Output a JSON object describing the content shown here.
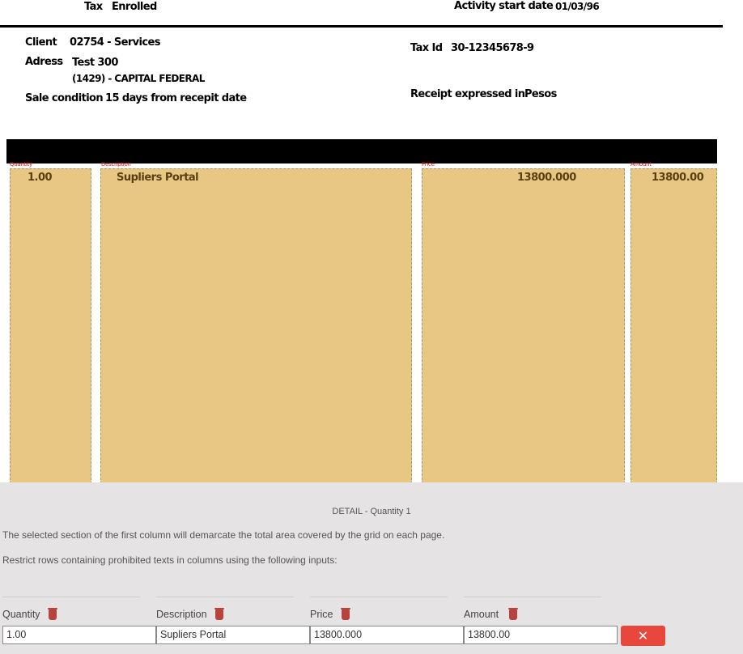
{
  "header": {
    "tax_label": "Tax",
    "tax_value": "Enrolled",
    "activity_label": "Activity start date",
    "activity_value": "01/03/96"
  },
  "client": {
    "client_label": "Client",
    "client_value": "02754 -  Services",
    "address_label": "Adress",
    "address_line1": "Test 300",
    "address_line2": "(1429) - CAPITAL FEDERAL",
    "sale_label": "Sale condition",
    "sale_value": "15 days from recepit date",
    "taxid_label": "Tax Id",
    "taxid_value": "30-12345678-9",
    "receipt_label": "Receipt expressed in",
    "receipt_value": "Pesos"
  },
  "grid": {
    "columns": [
      {
        "label": "Quantity",
        "value": "1.00"
      },
      {
        "label": "Description",
        "value": "Supliers Portal"
      },
      {
        "label": "Price",
        "value": "13800.000"
      },
      {
        "label": "Amount",
        "value": "13800.00"
      }
    ]
  },
  "panel": {
    "title": "DETAIL - Quantity 1",
    "info1": "The selected section of the first column will demarcate the total area covered by the grid on each page.",
    "info2": "Restrict rows containing prohibited texts in columns using the following inputs:",
    "fields": [
      {
        "label": "Quantity",
        "value": "1.00"
      },
      {
        "label": "Description",
        "value": "Supliers Portal"
      },
      {
        "label": "Price",
        "value": "13800.000"
      },
      {
        "label": "Amount",
        "value": "13800.00"
      }
    ],
    "delete_glyph": "✕"
  },
  "colors": {
    "column_fill": "#e8c785",
    "label_red": "#dd1111",
    "delete_button": "#e8473e",
    "trash_icon": "#b8433e",
    "panel_bg": "#e5e3e3"
  }
}
